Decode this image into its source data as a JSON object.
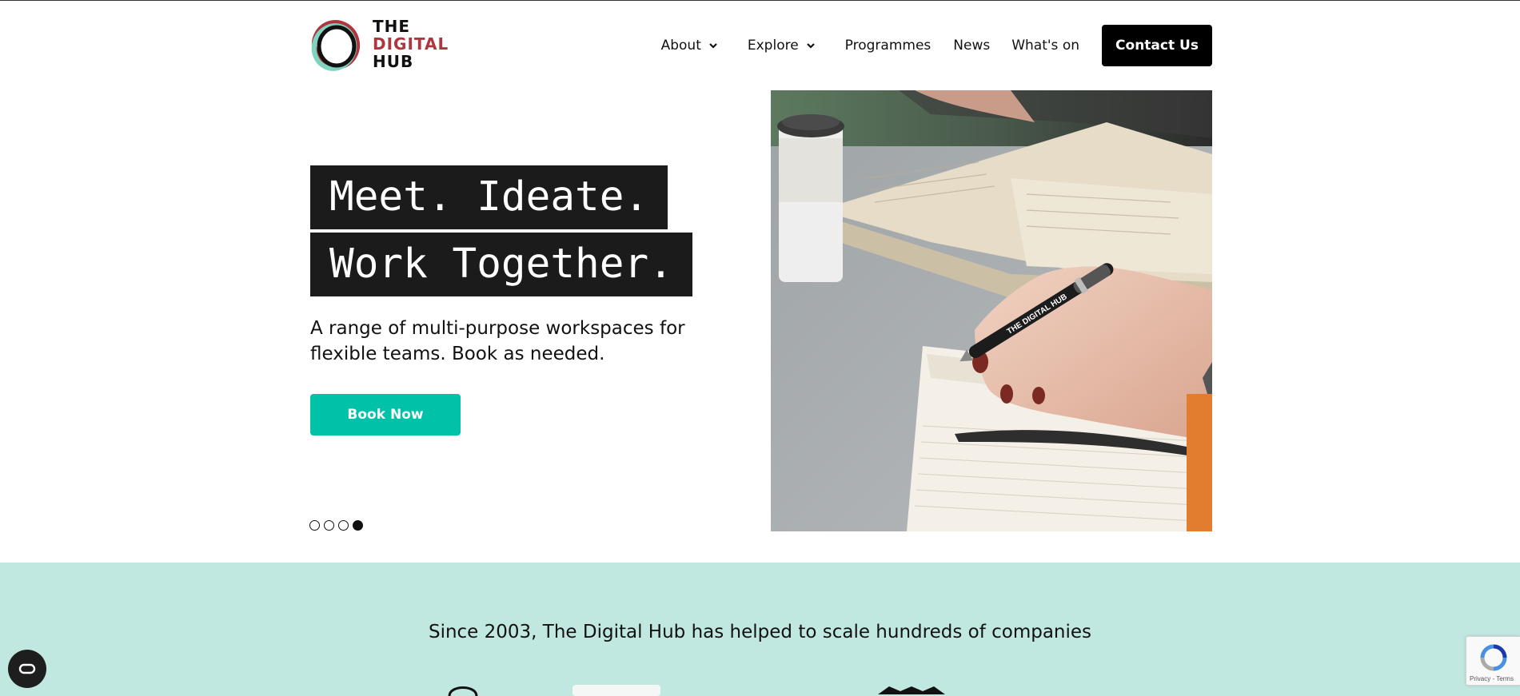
{
  "brand": {
    "logo_line1": "THE",
    "logo_line2": "DIGITAL",
    "logo_line3": "HUB",
    "colors": {
      "red": "#b0353e",
      "teal": "#7fd4c1",
      "black": "#111111"
    }
  },
  "nav": {
    "items": [
      {
        "label": "About",
        "has_dropdown": true
      },
      {
        "label": "Explore",
        "has_dropdown": true
      },
      {
        "label": "Programmes",
        "has_dropdown": false
      },
      {
        "label": "News",
        "has_dropdown": false
      },
      {
        "label": "What's on",
        "has_dropdown": false
      }
    ],
    "contact_label": "Contact Us"
  },
  "hero": {
    "headline_line1": "Meet. Ideate.",
    "headline_line2": "Work Together.",
    "subtext": "A range of multi-purpose workspaces for flexible teams. Book as needed.",
    "cta_label": "Book Now",
    "cta_color": "#00c2a9",
    "slides_total": 4,
    "active_slide": 4,
    "photo_subject": "hand writing in notebook with The Digital Hub pen",
    "pen_text": "THE DIGITAL HUB"
  },
  "band": {
    "background": "#c1e8e0",
    "title": "Since 2003, The Digital Hub has helped to scale hundreds of companies"
  },
  "widgets": {
    "accessibility_icon": "accessibility-toggle-icon",
    "recaptcha_text": "Privacy - Terms"
  }
}
